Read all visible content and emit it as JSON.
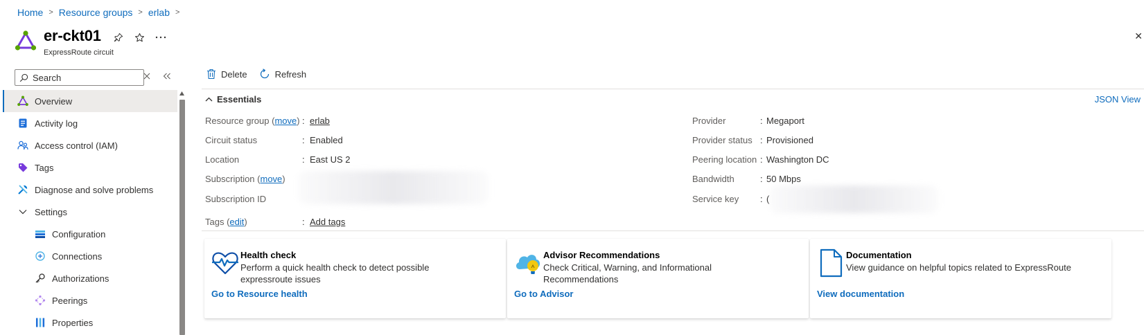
{
  "breadcrumb": [
    "Home",
    "Resource groups",
    "erlab"
  ],
  "header": {
    "title": "er-ckt01",
    "subtitle": "ExpressRoute circuit",
    "close": "✕"
  },
  "nav": {
    "search_placeholder": "Search",
    "items": [
      {
        "label": "Overview",
        "icon": "expressroute-icon"
      },
      {
        "label": "Activity log",
        "icon": "activity-log-icon"
      },
      {
        "label": "Access control (IAM)",
        "icon": "iam-icon"
      },
      {
        "label": "Tags",
        "icon": "tag-icon"
      },
      {
        "label": "Diagnose and solve problems",
        "icon": "diagnose-icon"
      },
      {
        "label": "Settings",
        "icon": "chevron-down-icon"
      },
      {
        "label": "Configuration",
        "icon": "configuration-icon"
      },
      {
        "label": "Connections",
        "icon": "connections-icon"
      },
      {
        "label": "Authorizations",
        "icon": "key-icon"
      },
      {
        "label": "Peerings",
        "icon": "peerings-icon"
      },
      {
        "label": "Properties",
        "icon": "properties-icon"
      }
    ]
  },
  "toolbar": {
    "delete": "Delete",
    "refresh": "Refresh"
  },
  "essentials": {
    "title": "Essentials",
    "json_view": "JSON View",
    "left": {
      "resource_group": {
        "label": "Resource group",
        "move": "move",
        "value": "erlab"
      },
      "circuit_status": {
        "label": "Circuit status",
        "value": "Enabled"
      },
      "location": {
        "label": "Location",
        "value": "East US 2"
      },
      "subscription": {
        "label": "Subscription",
        "move": "move",
        "value": ""
      },
      "subscription_id": {
        "label": "Subscription ID",
        "value": ""
      }
    },
    "right": {
      "provider": {
        "label": "Provider",
        "value": "Megaport"
      },
      "provider_status": {
        "label": "Provider status",
        "value": "Provisioned"
      },
      "peering_location": {
        "label": "Peering location",
        "value": "Washington DC"
      },
      "bandwidth": {
        "label": "Bandwidth",
        "value": "50 Mbps"
      },
      "service_key": {
        "label": "Service key",
        "value": "("
      }
    },
    "tags": {
      "label": "Tags",
      "edit": "edit",
      "value": "Add tags"
    },
    "colon": ":"
  },
  "cards": [
    {
      "title": "Health check",
      "description": "Perform a quick health check to detect possible expressroute issues",
      "link": "Go to Resource health",
      "icon": "health-heart-icon"
    },
    {
      "title": "Advisor Recommendations",
      "description": "Check Critical, Warning, and Informational Recommendations",
      "link": "Go to Advisor",
      "icon": "advisor-cloud-icon"
    },
    {
      "title": "Documentation",
      "description": "View guidance on helpful topics related to ExpressRoute",
      "link": "View documentation",
      "icon": "document-icon"
    }
  ],
  "colors": {
    "accent": "#0f6cbd",
    "nav_active_bg": "#edebe9",
    "expressroute_purple": "#773adc",
    "expressroute_green": "#57a300"
  }
}
